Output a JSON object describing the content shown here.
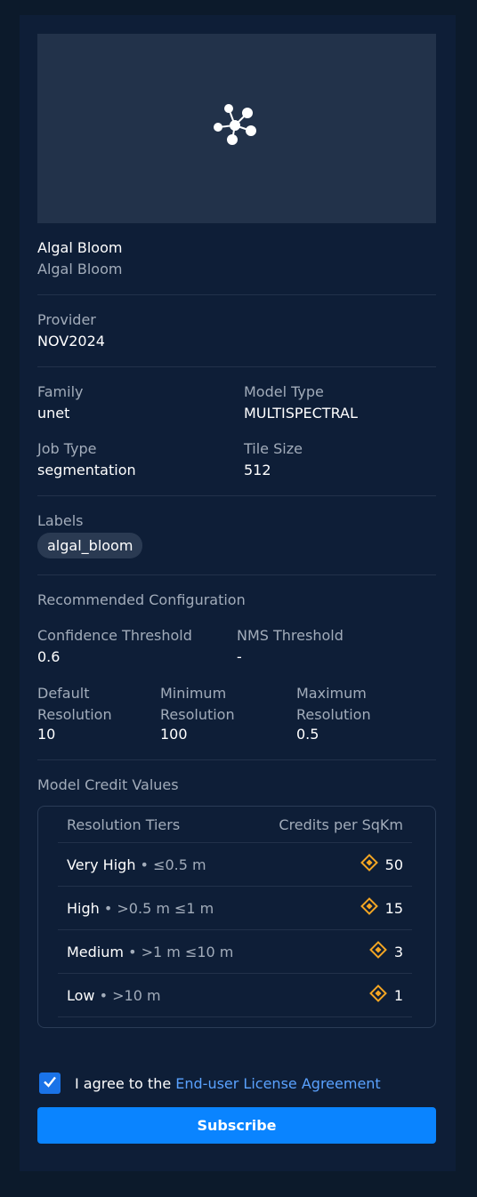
{
  "model": {
    "title": "Algal Bloom",
    "subtitle": "Algal Bloom"
  },
  "provider": {
    "label": "Provider",
    "value": "NOV2024"
  },
  "family": {
    "label": "Family",
    "value": "unet"
  },
  "model_type": {
    "label": "Model Type",
    "value": "MULTISPECTRAL"
  },
  "job_type": {
    "label": "Job Type",
    "value": "segmentation"
  },
  "tile_size": {
    "label": "Tile Size",
    "value": "512"
  },
  "labels": {
    "title": "Labels",
    "items": [
      "algal_bloom"
    ]
  },
  "config": {
    "title": "Recommended Configuration",
    "confidence": {
      "label": "Confidence Threshold",
      "value": "0.6"
    },
    "nms": {
      "label": "NMS Threshold",
      "value": "-"
    },
    "default_res": {
      "label_line1": "Default",
      "label_line2": "Resolution",
      "value": "10"
    },
    "min_res": {
      "label_line1": "Minimum",
      "label_line2": "Resolution",
      "value": "100"
    },
    "max_res": {
      "label_line1": "Maximum",
      "label_line2": "Resolution",
      "value": "0.5"
    }
  },
  "credits": {
    "title": "Model Credit Values",
    "col_tier": "Resolution Tiers",
    "col_credits": "Credits per SqKm",
    "rows": [
      {
        "name": "Very High",
        "range": "• ≤0.5 m",
        "credits": "50"
      },
      {
        "name": "High",
        "range": "• >0.5 m ≤1 m",
        "credits": "15"
      },
      {
        "name": "Medium",
        "range": "• >1 m ≤10 m",
        "credits": "3"
      },
      {
        "name": "Low",
        "range": "• >10 m",
        "credits": "1"
      }
    ],
    "icon": "credit-diamond-icon",
    "accent": "#f5a623"
  },
  "agreement": {
    "checked": true,
    "text": "I agree to the",
    "link": "End-user License Agreement"
  },
  "subscribe_label": "Subscribe",
  "colors": {
    "accent": "#0a84ff",
    "link": "#5aa2ff",
    "background": "#0e1e37"
  }
}
